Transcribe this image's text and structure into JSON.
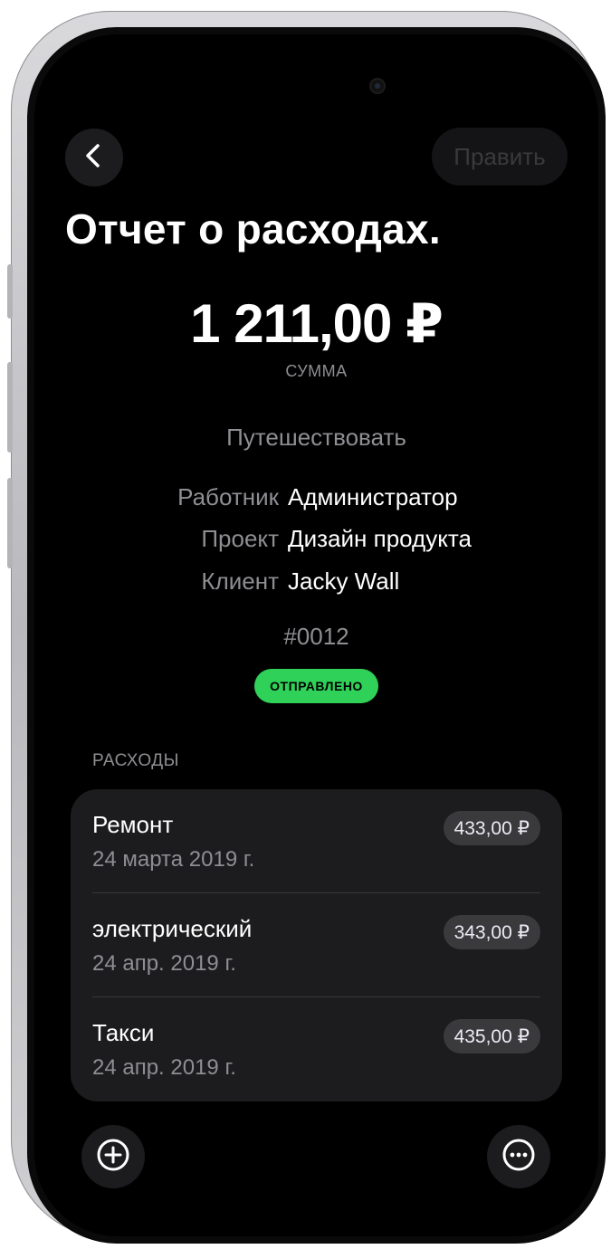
{
  "header": {
    "back_icon": "chevron-left-icon",
    "edit_label": "Править"
  },
  "report": {
    "title": "Отчет о расходах.",
    "amount": "1 211,00 ₽",
    "amount_label": "СУММА",
    "category": "Путешествовать",
    "details": [
      {
        "key": "Работник",
        "value": "Администратор"
      },
      {
        "key": "Проект",
        "value": "Дизайн продукта"
      },
      {
        "key": "Клиент",
        "value": "Jacky Wall"
      }
    ],
    "number": "#0012",
    "status": "ОТПРАВЛЕНО",
    "status_color": "#30d158"
  },
  "expenses": {
    "header": "РАСХОДЫ",
    "items": [
      {
        "name": "Ремонт",
        "date": "24 марта 2019 г.",
        "amount": "433,00 ₽"
      },
      {
        "name": "электрический",
        "date": "24 апр. 2019 г.",
        "amount": "343,00 ₽"
      },
      {
        "name": "Такси",
        "date": "24 апр. 2019 г.",
        "amount": "435,00 ₽"
      }
    ]
  },
  "toolbar": {
    "add_icon": "plus-circle-icon",
    "more_icon": "ellipsis-circle-icon"
  },
  "colors": {
    "background": "#000000",
    "card": "#1c1c1e",
    "secondary_text": "#8e8e93",
    "accent_green": "#30d158"
  }
}
